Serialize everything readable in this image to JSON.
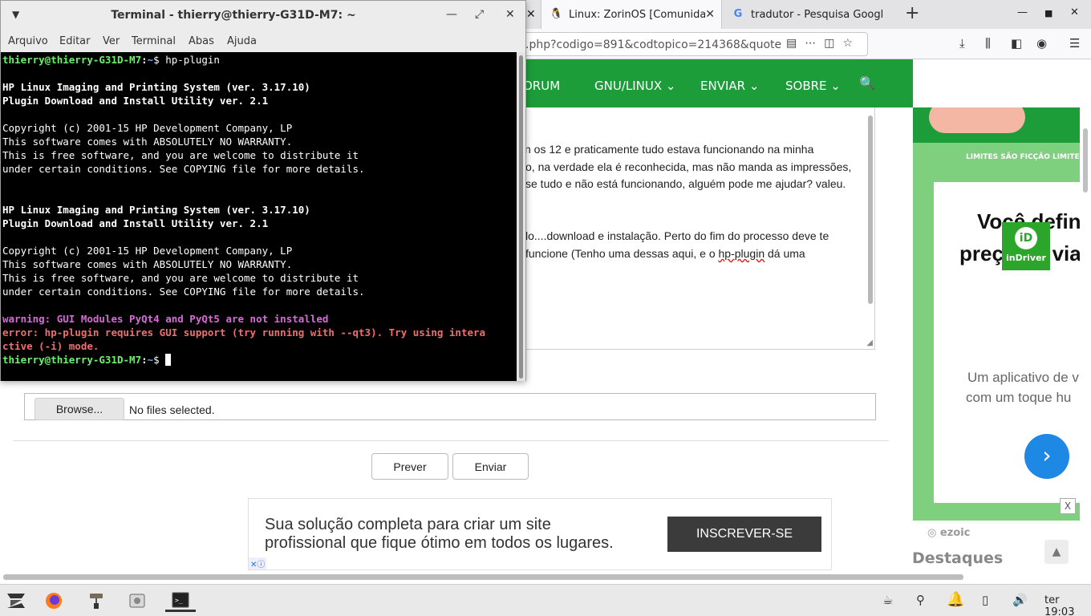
{
  "firefox": {
    "tabs": [
      {
        "label": "Linux: ZorinOS [Comunida",
        "favicon": "penguin-icon"
      },
      {
        "label": "tradutor - Pesquisa Googl",
        "favicon": "google-icon"
      }
    ],
    "url": ".php?codigo=891&codtopico=214368&quote",
    "site_nav": [
      "ORUM",
      "GNU/LINUX ⌄",
      "ENVIAR ⌄",
      "SOBRE ⌄"
    ],
    "post_lines": [
      "n os 12 e praticamente tudo estava funcionando na minha",
      "o, na verdade ela é reconhecida, mas não manda as impressões,",
      "se tudo e não está funcionando, alguém pode me ajudar? valeu.",
      "",
      "lo....download e instalação. Perto do fim do processo deve te",
      "funcione (Tenho uma dessas aqui, e o "
    ],
    "post_underlined": "hp-plugin",
    "post_after_underline": " dá uma",
    "attach": {
      "browse": "Browse...",
      "status": "No files selected."
    },
    "buttons": {
      "preview": "Prever",
      "send": "Enviar"
    },
    "sidebar": {
      "slogan": "LIMITES SÃO FICÇÃO LIMITES N",
      "headline": [
        "Você defin",
        "preço da via"
      ],
      "brand": "inDriver",
      "desc": [
        "Um aplicativo de v",
        "com um toque hu"
      ],
      "close": "X",
      "ezoic": "ezoic",
      "destaques": "Destaques"
    },
    "ad": {
      "line1": "Sua solução completa para criar um site",
      "line2": "profissional que fique ótimo em todos os lugares.",
      "cta": "INSCREVER-SE"
    }
  },
  "terminal": {
    "title": "Terminal - thierry@thierry-G31D-M7: ~",
    "menu": [
      "Arquivo",
      "Editar",
      "Ver",
      "Terminal",
      "Abas",
      "Ajuda"
    ],
    "prompt_user": "thierry@thierry-G31D-M7",
    "prompt_sep": ":",
    "prompt_path": "~",
    "prompt_dollar": "$",
    "command": " hp-plugin",
    "lines": [
      {
        "text": "",
        "style": "plain"
      },
      {
        "text": "HP Linux Imaging and Printing System (ver. 3.17.10)",
        "style": "bold"
      },
      {
        "text": "Plugin Download and Install Utility ver. 2.1",
        "style": "bold"
      },
      {
        "text": "",
        "style": "plain"
      },
      {
        "text": "Copyright (c) 2001-15 HP Development Company, LP",
        "style": "plain"
      },
      {
        "text": "This software comes with ABSOLUTELY NO WARRANTY.",
        "style": "plain"
      },
      {
        "text": "This is free software, and you are welcome to distribute it",
        "style": "plain"
      },
      {
        "text": "under certain conditions. See COPYING file for more details.",
        "style": "plain"
      },
      {
        "text": "",
        "style": "plain"
      },
      {
        "text": "",
        "style": "plain"
      },
      {
        "text": "HP Linux Imaging and Printing System (ver. 3.17.10)",
        "style": "bold"
      },
      {
        "text": "Plugin Download and Install Utility ver. 2.1",
        "style": "bold"
      },
      {
        "text": "",
        "style": "plain"
      },
      {
        "text": "Copyright (c) 2001-15 HP Development Company, LP",
        "style": "plain"
      },
      {
        "text": "This software comes with ABSOLUTELY NO WARRANTY.",
        "style": "plain"
      },
      {
        "text": "This is free software, and you are welcome to distribute it",
        "style": "plain"
      },
      {
        "text": "under certain conditions. See COPYING file for more details.",
        "style": "plain"
      },
      {
        "text": "",
        "style": "plain"
      },
      {
        "text": "warning: GUI Modules PyQt4 and PyQt5 are not installed",
        "style": "warn"
      },
      {
        "text": "error: hp-plugin requires GUI support (try running with --qt3). Try using intera",
        "style": "err"
      },
      {
        "text": "ctive (-i) mode.",
        "style": "err"
      }
    ]
  },
  "taskbar": {
    "apps": [
      "zorin-menu-icon",
      "firefox-icon",
      "paint-roller-icon",
      "software-icon",
      "terminal-icon"
    ],
    "tray": [
      "coffee-icon",
      "network-icon",
      "bell-icon",
      "battery-icon",
      "volume-icon"
    ],
    "clock": "ter 19:03"
  },
  "colors": {
    "site_green": "#1c9d3a",
    "terminal_bg": "#000000",
    "prompt_green": "#6df26d",
    "prompt_blue": "#7aa7ff",
    "warn_magenta": "#d86ad8",
    "error_red": "#ef6f6f"
  }
}
